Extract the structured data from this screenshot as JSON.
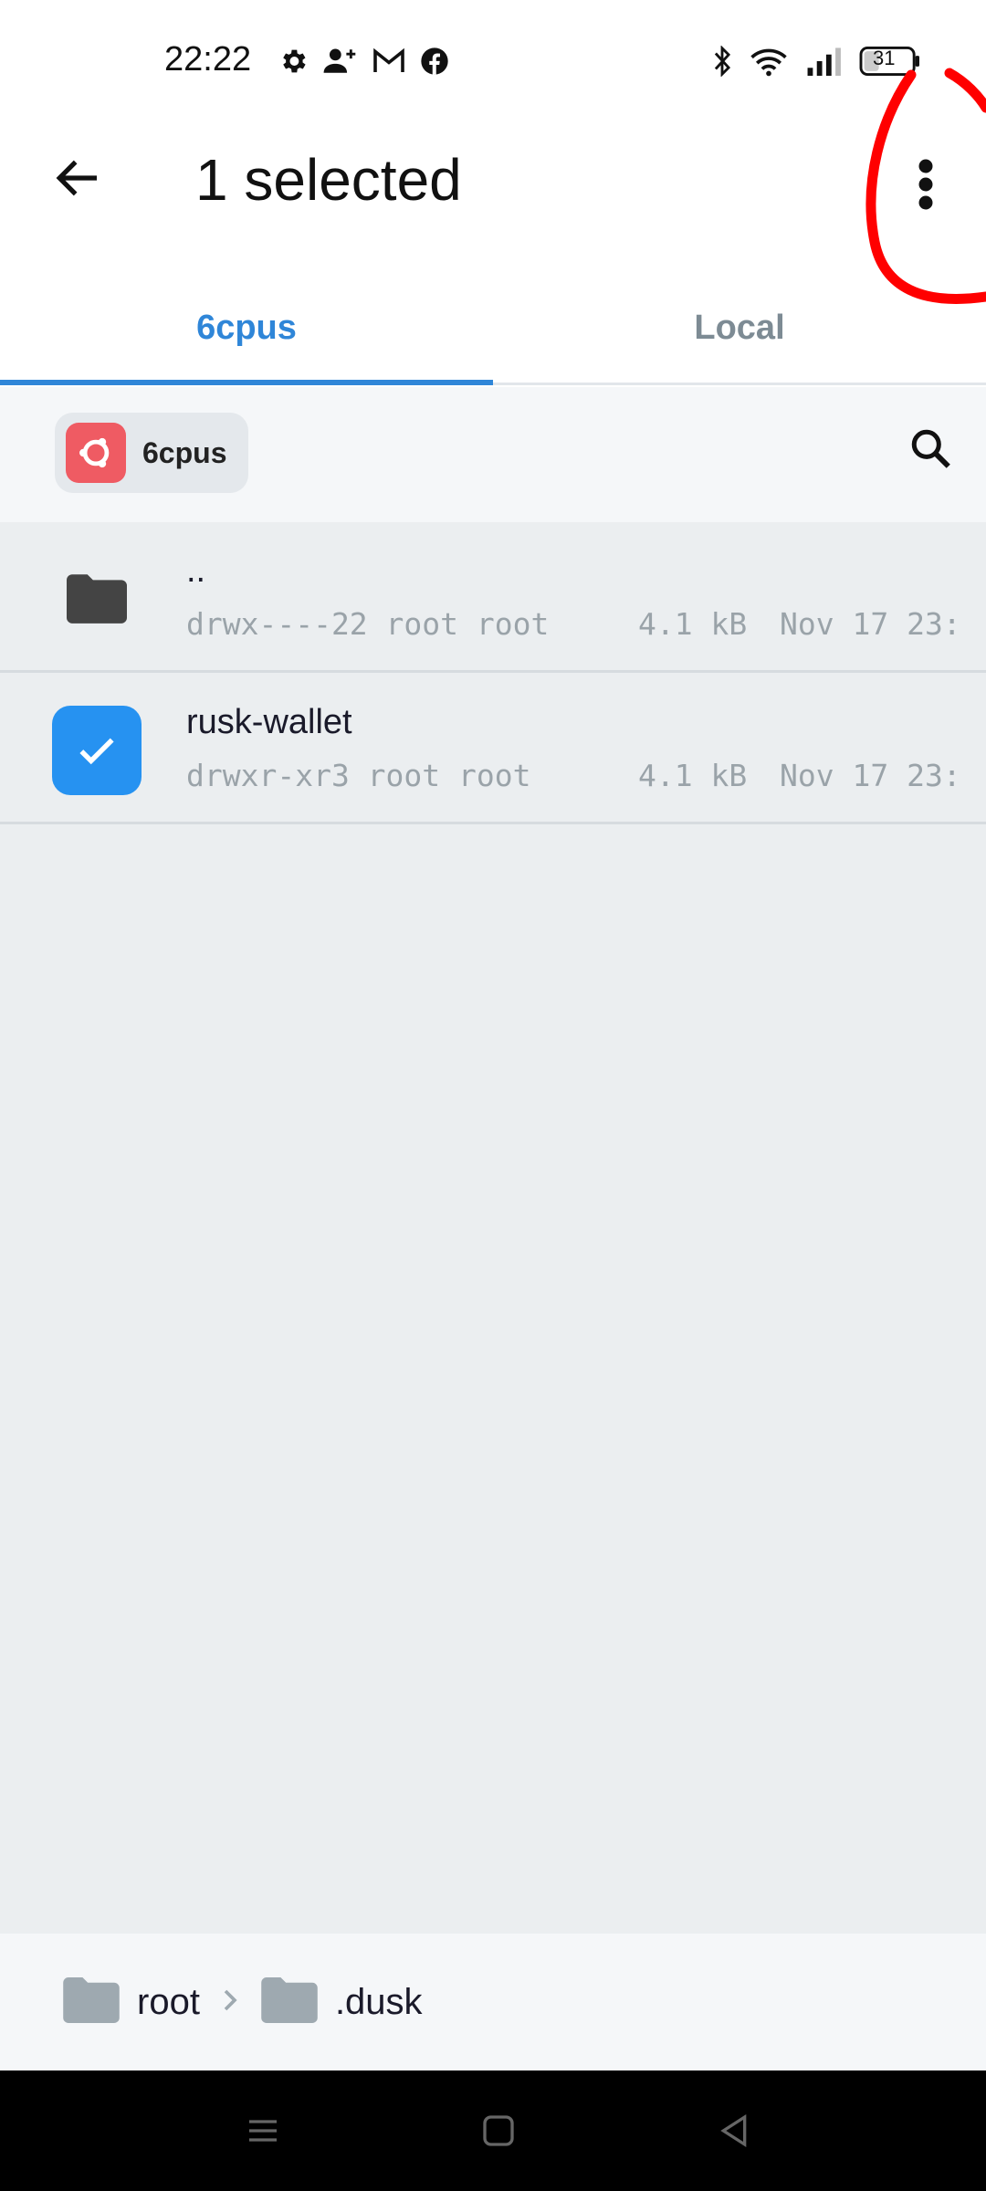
{
  "status_bar": {
    "time": "22:22",
    "left_icons": [
      "settings-icon",
      "person-add-icon",
      "gmail-icon",
      "facebook-icon"
    ],
    "right_icons": [
      "bluetooth-icon",
      "wifi-icon",
      "signal-icon"
    ],
    "battery": "31"
  },
  "app_bar": {
    "title": "1 selected",
    "back_icon": "arrow-back-icon",
    "more_icon": "more-vert-icon"
  },
  "tabs": [
    {
      "label": "6cpus",
      "active": true
    },
    {
      "label": "Local",
      "active": false
    }
  ],
  "server": {
    "name": "6cpus",
    "logo": "ubuntu-logo-icon"
  },
  "files": [
    {
      "name": "..",
      "permissions": "drwx----22 root root",
      "size": "4.1 kB",
      "date": "Nov 17 23:",
      "selected": false,
      "icon": "folder-icon"
    },
    {
      "name": "rusk-wallet",
      "permissions": "drwxr-xr3 root root",
      "size": "4.1 kB",
      "date": "Nov 17 23:",
      "selected": true,
      "icon": "checkbox-checked-icon"
    }
  ],
  "breadcrumb": [
    {
      "label": "root"
    },
    {
      "label": ".dusk"
    }
  ],
  "colors": {
    "accent": "#2f86d8",
    "checkbox": "#2692f1",
    "server_logo": "#ef5b63",
    "annotation": "#ff0000"
  }
}
